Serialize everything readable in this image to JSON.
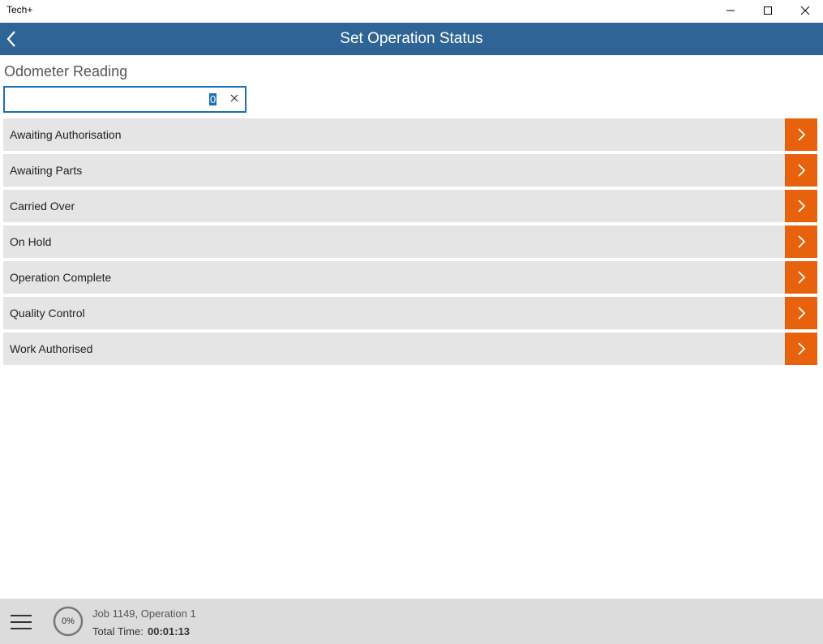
{
  "window": {
    "title": "Tech+"
  },
  "header": {
    "title": "Set Operation Status"
  },
  "odometer": {
    "label": "Odometer Reading",
    "value": "0"
  },
  "statuses": [
    {
      "label": "Awaiting Authorisation"
    },
    {
      "label": "Awaiting Parts"
    },
    {
      "label": "Carried Over"
    },
    {
      "label": "On Hold"
    },
    {
      "label": "Operation Complete"
    },
    {
      "label": "Quality Control"
    },
    {
      "label": "Work Authorised"
    }
  ],
  "footer": {
    "progress": "0%",
    "progress_fraction": 0,
    "job": "Job 1149, Operation 1",
    "total_time_label": "Total Time:",
    "total_time_value": "00:01:13"
  },
  "icons": {
    "back": "chevron-left-icon",
    "go": "chevron-right-icon",
    "clear": "close-icon",
    "menu": "hamburger-menu-icon",
    "minimize": "minimize-icon",
    "maximize": "maximize-icon",
    "close": "close-icon"
  },
  "colors": {
    "header": "#2f6496",
    "accent": "#e8620e",
    "input_focus": "#1a6fb7",
    "row": "#e5e5e5",
    "footer": "#dcdcdc"
  }
}
